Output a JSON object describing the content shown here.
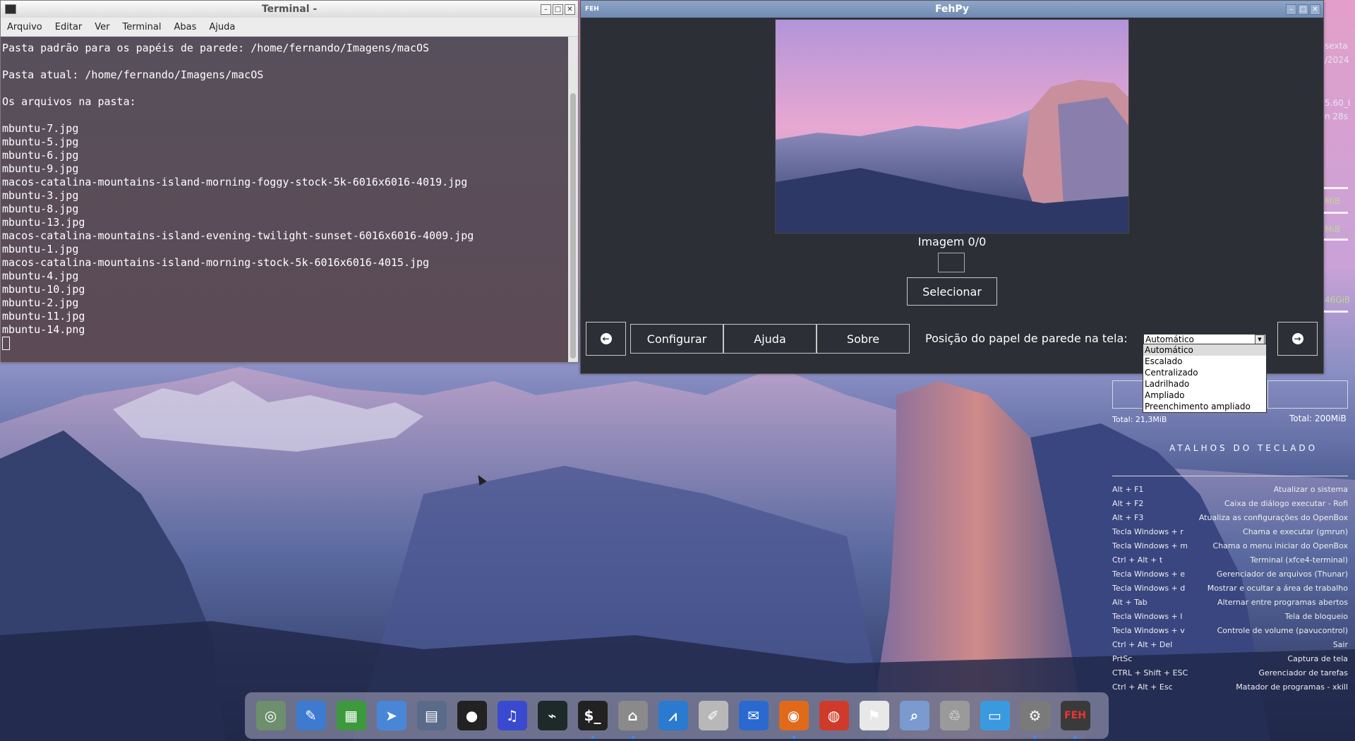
{
  "terminal": {
    "title": "Terminal -",
    "menu": [
      "Arquivo",
      "Editar",
      "Ver",
      "Terminal",
      "Abas",
      "Ajuda"
    ],
    "lines": [
      "Pasta padrão para os papéis de parede: /home/fernando/Imagens/macOS",
      "",
      "Pasta atual: /home/fernando/Imagens/macOS",
      "",
      "Os arquivos na pasta:",
      "",
      "mbuntu-7.jpg",
      "mbuntu-5.jpg",
      "mbuntu-6.jpg",
      "mbuntu-9.jpg",
      "macos-catalina-mountains-island-morning-foggy-stock-5k-6016x6016-4019.jpg",
      "mbuntu-3.jpg",
      "mbuntu-8.jpg",
      "mbuntu-13.jpg",
      "macos-catalina-mountains-island-evening-twilight-sunset-6016x6016-4009.jpg",
      "mbuntu-1.jpg",
      "macos-catalina-mountains-island-morning-stock-5k-6016x6016-4015.jpg",
      "mbuntu-4.jpg",
      "mbuntu-10.jpg",
      "mbuntu-2.jpg",
      "mbuntu-11.jpg",
      "mbuntu-14.png"
    ]
  },
  "fehpy": {
    "title": "FehPy",
    "icon_text": "FEH",
    "image_counter": "Imagem 0/0",
    "select_label": "Selecionar",
    "buttons": {
      "configure": "Configurar",
      "help": "Ajuda",
      "about": "Sobre"
    },
    "position_label": "Posição do papel de parede na tela:",
    "position_selected": "Automático",
    "position_options": [
      "Automático",
      "Escalado",
      "Centralizado",
      "Ladrilhado",
      "Ampliado",
      "Preenchimento ampliado"
    ]
  },
  "conky": {
    "partial_texts": [
      "sexta",
      "/2024",
      "5.60_I",
      "n 28s",
      "MiB",
      "MiB",
      "46GiB"
    ],
    "total_left": "Total: 21,3MiB",
    "total_right": "Total: 200MiB",
    "shortcuts_title": "ATALHOS DO TECLADO",
    "shortcuts": [
      {
        "key": "Alt + F1",
        "action": "Atualizar o sistema"
      },
      {
        "key": "Alt + F2",
        "action": "Caixa de diálogo executar - Rofi"
      },
      {
        "key": "Alt + F3",
        "action": "Atualiza as configurações do OpenBox"
      },
      {
        "key": "Tecla Windows + r",
        "action": "Chama e executar (gmrun)"
      },
      {
        "key": "Tecla Windows + m",
        "action": "Chama o menu iniciar do OpenBox"
      },
      {
        "key": "Ctrl + Alt + t",
        "action": "Terminal (xfce4-terminal)"
      },
      {
        "key": "Tecla Windows + e",
        "action": "Gerenciador de arquivos (Thunar)"
      },
      {
        "key": "Tecla Windows + d",
        "action": "Mostrar e ocultar a área de trabalho"
      },
      {
        "key": "Alt + Tab",
        "action": "Alternar entre programas abertos"
      },
      {
        "key": "Tecla Windows + l",
        "action": "Tela de bloqueio"
      },
      {
        "key": "Tecla Windows + v",
        "action": "Controle de volume (pavucontrol)"
      },
      {
        "key": "Ctrl + Alt + Del",
        "action": "Sair"
      },
      {
        "key": "PrtSc",
        "action": "Captura de tela"
      },
      {
        "key": "CTRL + Shift + ESC",
        "action": "Gerenciador de tarefas"
      },
      {
        "key": "Ctrl + Alt + Esc",
        "action": "Matador de programas - xkill"
      }
    ]
  },
  "dock": {
    "items": [
      {
        "name": "system-settings-ring-icon",
        "color": "#6d8f6d",
        "glyph": "◎",
        "running": false
      },
      {
        "name": "text-editor-icon",
        "color": "#3d7ad0",
        "glyph": "✎",
        "running": false
      },
      {
        "name": "spreadsheet-icon",
        "color": "#3c9a3c",
        "glyph": "▦",
        "running": false
      },
      {
        "name": "arrow-app-icon",
        "color": "#4a86d8",
        "glyph": "➤",
        "running": false
      },
      {
        "name": "calculator-icon",
        "color": "#5a6a8a",
        "glyph": "▤",
        "running": false
      },
      {
        "name": "camera-icon",
        "color": "#222222",
        "glyph": "●",
        "running": false
      },
      {
        "name": "headphones-icon",
        "color": "#3a4ad0",
        "glyph": "♫",
        "running": false
      },
      {
        "name": "system-monitor-icon",
        "color": "#1e2a2a",
        "glyph": "⌁",
        "running": false
      },
      {
        "name": "terminal-icon",
        "color": "#222222",
        "glyph": "$_",
        "running": true
      },
      {
        "name": "home-folder-icon",
        "color": "#8a8a8a",
        "glyph": "⌂",
        "running": true
      },
      {
        "name": "activity-monitor-icon",
        "color": "#2a7ad0",
        "glyph": "⩘",
        "running": false
      },
      {
        "name": "notepad-icon",
        "color": "#b8b8b8",
        "glyph": "✐",
        "running": false
      },
      {
        "name": "thunderbird-icon",
        "color": "#2a6ad0",
        "glyph": "✉",
        "running": false
      },
      {
        "name": "firefox-icon",
        "color": "#e06a1a",
        "glyph": "◉",
        "running": true
      },
      {
        "name": "chrome-icon",
        "color": "#d03a2a",
        "glyph": "◍",
        "running": false
      },
      {
        "name": "flag-app-icon",
        "color": "#e8e8e8",
        "glyph": "⚑",
        "running": false
      },
      {
        "name": "file-search-icon",
        "color": "#7a9ad0",
        "glyph": "⌕",
        "running": false
      },
      {
        "name": "trash-icon",
        "color": "#9a9a9a",
        "glyph": "♲",
        "running": false
      },
      {
        "name": "window-app-icon",
        "color": "#3a9ae0",
        "glyph": "▭",
        "running": false
      },
      {
        "name": "gear-icon",
        "color": "#7a7a7a",
        "glyph": "⚙",
        "running": true
      },
      {
        "name": "feh-app-icon",
        "color": "#3a3a3a",
        "glyph": "FEH",
        "running": true
      }
    ]
  }
}
